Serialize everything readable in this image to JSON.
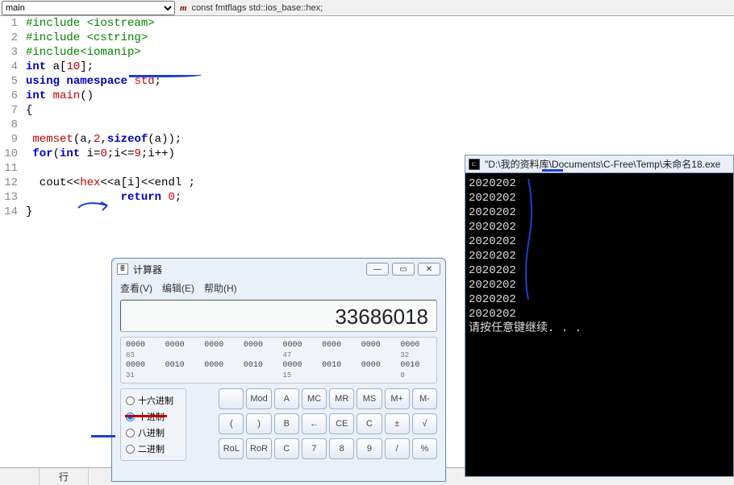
{
  "toolbar": {
    "dropdown": "main",
    "symbol": "const fmtflags std::ios_base::hex;"
  },
  "code": {
    "lines": [
      {
        "n": 1,
        "html": "<span class='pre'>#include &lt;iostream&gt;</span>"
      },
      {
        "n": 2,
        "html": "<span class='pre'>#include &lt;cstring&gt;</span>"
      },
      {
        "n": 3,
        "html": "<span class='pre'>#include&lt;iomanip&gt;</span>"
      },
      {
        "n": 4,
        "html": "<span class='kw'>int</span> a[<span class='num'>10</span>];"
      },
      {
        "n": 5,
        "html": "<span class='kw'>using</span> <span class='kw'>namespace</span> <span class='func'>std</span>;"
      },
      {
        "n": 6,
        "html": "<span class='kw'>int</span> <span class='func'>main</span>()"
      },
      {
        "n": 7,
        "html": "{"
      },
      {
        "n": 8,
        "html": ""
      },
      {
        "n": 9,
        "html": " <span class='func'>memset</span>(a,<span class='num'>2</span>,<span class='kw'>sizeof</span>(a));"
      },
      {
        "n": 10,
        "html": " <span class='kw'>for</span>(<span class='kw'>int</span> i=<span class='num'>0</span>;i&lt;=<span class='num'>9</span>;i++)"
      },
      {
        "n": 11,
        "html": ""
      },
      {
        "n": 12,
        "html": "  cout&lt;&lt;<span class='func'>hex</span>&lt;&lt;a[i]&lt;&lt;endl ;"
      },
      {
        "n": 13,
        "html": "              <span class='kw'>return</span> <span class='num'>0</span>;"
      },
      {
        "n": 14,
        "html": "}"
      }
    ]
  },
  "statusbar": {
    "line_label": "行"
  },
  "calc": {
    "title": "计算器",
    "menu": [
      "查看(V)",
      "编辑(E)",
      "帮助(H)"
    ],
    "display": "33686018",
    "bits_row1": [
      "0000",
      "0000",
      "0000",
      "0000",
      "0000",
      "0000",
      "0000",
      "0000"
    ],
    "bits_lab1": [
      "63",
      "",
      "",
      "",
      "47",
      "",
      "",
      "32"
    ],
    "bits_row2": [
      "0000",
      "0010",
      "0000",
      "0010",
      "0000",
      "0010",
      "0000",
      "0010"
    ],
    "bits_lab2": [
      "31",
      "",
      "",
      "",
      "15",
      "",
      "",
      "0"
    ],
    "radix": [
      {
        "label": "十六进制",
        "checked": false
      },
      {
        "label": "十进制",
        "checked": true
      },
      {
        "label": "八进制",
        "checked": false
      },
      {
        "label": "二进制",
        "checked": false
      }
    ],
    "buttons_row1": [
      "",
      "Mod",
      "A",
      "MC",
      "MR",
      "MS",
      "M+",
      "M-"
    ],
    "buttons_row2": [
      "(",
      ")",
      "B",
      "←",
      "CE",
      "C",
      "±",
      "√"
    ],
    "buttons_row3": [
      "RoL",
      "RoR",
      "C",
      "7",
      "8",
      "9",
      "/",
      "%"
    ]
  },
  "console": {
    "title": "\"D:\\我的资料库\\Documents\\C-Free\\Temp\\未命名18.exe",
    "lines": [
      "2020202",
      "2020202",
      "2020202",
      "2020202",
      "2020202",
      "2020202",
      "2020202",
      "2020202",
      "2020202",
      "2020202"
    ],
    "prompt": "请按任意键继续. . ."
  }
}
